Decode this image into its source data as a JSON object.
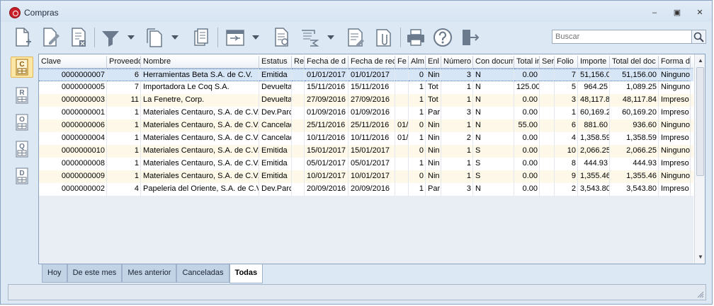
{
  "window": {
    "title": "Compras",
    "minimize": "–",
    "restore": "▣",
    "close": "✕"
  },
  "search": {
    "placeholder": "Buscar"
  },
  "columns": [
    "Clave",
    "Proveedor",
    "Nombre",
    "Estatus",
    "Re",
    "Fecha de d",
    "Fecha de rec",
    "Fe",
    "Alm",
    "Enl",
    "Número",
    "Con docum",
    "Total ir",
    "Ser",
    "Folio",
    "Importe",
    "Total del doc",
    "Forma de"
  ],
  "rows": [
    [
      "0000000007",
      "6",
      "Herramientas Beta S.A. de C.V.",
      "Emitida",
      "",
      "01/01/2017",
      "01/01/2017",
      "",
      "0",
      "Nin",
      "3",
      "N",
      "0.00",
      "",
      "7",
      "51,156.0",
      "51,156.00",
      "Ninguno"
    ],
    [
      "0000000005",
      "7",
      "Importadora Le Coq S.A.",
      "Devuelta",
      "",
      "15/11/2016",
      "15/11/2016",
      "",
      "1",
      "Tot",
      "1",
      "N",
      "125.00",
      "",
      "5",
      "964.25",
      "1,089.25",
      "Ninguno"
    ],
    [
      "0000000003",
      "11",
      "La Fenetre, Corp.",
      "Devuelta",
      "",
      "27/09/2016",
      "27/09/2016",
      "",
      "1",
      "Tot",
      "1",
      "N",
      "0.00",
      "",
      "3",
      "48,117.8",
      "48,117.84",
      "Impreso"
    ],
    [
      "0000000001",
      "1",
      "Materiales Centauro, S.A. de C.V.",
      "Dev.Parc",
      "",
      "01/09/2016",
      "01/09/2016",
      "",
      "1",
      "Par",
      "3",
      "N",
      "0.00",
      "",
      "1",
      "60,169.2",
      "60,169.20",
      "Impreso"
    ],
    [
      "0000000006",
      "1",
      "Materiales Centauro, S.A. de C.V.",
      "Cancelad",
      "",
      "25/11/2016",
      "25/11/2016",
      "01/",
      "0",
      "Nin",
      "1",
      "N",
      "55.00",
      "",
      "6",
      "881.60",
      "936.60",
      "Ninguno"
    ],
    [
      "0000000004",
      "1",
      "Materiales Centauro, S.A. de C.V.",
      "Cancelad",
      "",
      "10/11/2016",
      "10/11/2016",
      "01/",
      "1",
      "Nin",
      "2",
      "N",
      "0.00",
      "",
      "4",
      "1,358.59",
      "1,358.59",
      "Impreso"
    ],
    [
      "0000000010",
      "1",
      "Materiales Centauro, S.A. de C.V.",
      "Emitida",
      "",
      "15/01/2017",
      "15/01/2017",
      "",
      "0",
      "Nin",
      "1",
      "S",
      "0.00",
      "",
      "10",
      "2,066.25",
      "2,066.25",
      "Ninguno"
    ],
    [
      "0000000008",
      "1",
      "Materiales Centauro, S.A. de C.V.",
      "Emitida",
      "",
      "05/01/2017",
      "05/01/2017",
      "",
      "1",
      "Nin",
      "1",
      "S",
      "0.00",
      "",
      "8",
      "444.93",
      "444.93",
      "Impreso"
    ],
    [
      "0000000009",
      "1",
      "Materiales Centauro, S.A. de C.V.",
      "Emitida",
      "",
      "10/01/2017",
      "10/01/2017",
      "",
      "0",
      "Nin",
      "1",
      "S",
      "0.00",
      "",
      "9",
      "1,355.46",
      "1,355.46",
      "Ninguno"
    ],
    [
      "0000000002",
      "4",
      "Papeleria del Oriente, S.A. de C.V.",
      "Dev.Parc",
      "",
      "20/09/2016",
      "20/09/2016",
      "",
      "1",
      "Par",
      "3",
      "N",
      "0.00",
      "",
      "2",
      "3,543.80",
      "3,543.80",
      "Impreso"
    ]
  ],
  "tabs": [
    "Hoy",
    "De este mes",
    "Mes anterior",
    "Canceladas",
    "Todas"
  ],
  "active_tab": "Todas",
  "side_buttons": [
    "C",
    "R",
    "O",
    "Q",
    "D"
  ],
  "colors": {
    "accent": "#fde7a6",
    "selected_row": "#d7e6f7",
    "alt_row": "#fdf8e7"
  }
}
